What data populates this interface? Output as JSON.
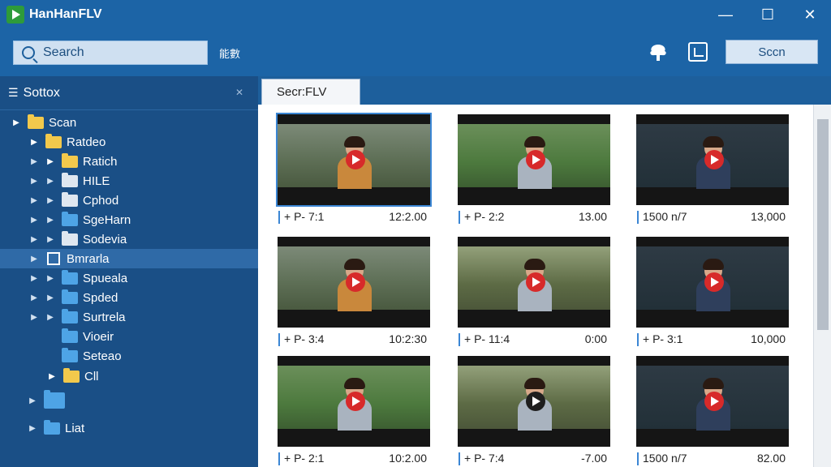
{
  "app": {
    "title": "HanHanFLV",
    "window_controls": {
      "minimize": "—",
      "maximize": "☐",
      "close": "✕"
    }
  },
  "toolbar": {
    "search_placeholder": "Search",
    "cjk_label": "能數",
    "scan_label": "Sccn"
  },
  "sidebar": {
    "title": "Sottox",
    "list_icon": "☰",
    "pin_icon": "✕",
    "items": [
      {
        "label": "Scan",
        "arrow": "▶",
        "icon": "folder-yellow"
      },
      {
        "label": "Ratdeo",
        "arrow": "▶",
        "icon": "folder-yellow"
      },
      {
        "label": "Ratich",
        "arrow": "▶",
        "icon": "folder-yellow"
      },
      {
        "label": "HILE",
        "arrow": "▶",
        "icon": "folder-white"
      },
      {
        "label": "Cphod",
        "arrow": "▶",
        "icon": "folder-white"
      },
      {
        "label": "SgeHarn",
        "arrow": "▶",
        "icon": "folder-blue"
      },
      {
        "label": "Sodevia",
        "arrow": "▶",
        "icon": "folder-white"
      },
      {
        "label": "Bmrarla",
        "arrow": "▶",
        "icon": "checkbox"
      },
      {
        "label": "Spueala",
        "arrow": "▶",
        "icon": "folder-blue"
      },
      {
        "label": "Spded",
        "arrow": "▶",
        "icon": "folder-blue"
      },
      {
        "label": "Surtrela",
        "arrow": "▶",
        "icon": "folder-blue"
      },
      {
        "label": "Vioeir",
        "arrow": "",
        "icon": "folder-blue"
      },
      {
        "label": "Seteao",
        "arrow": "",
        "icon": "folder-blue"
      },
      {
        "label": "Cll",
        "arrow": "▶",
        "icon": "folder-yellow"
      },
      {
        "label": "",
        "arrow": "▶",
        "icon": "folder-blue"
      },
      {
        "label": "Liat",
        "arrow": "▶",
        "icon": "folder-blue"
      }
    ]
  },
  "tab": {
    "label": "Secr:FLV"
  },
  "videos": [
    {
      "left": "+ P- 7:1",
      "right": "12:2.00",
      "scene": "forest",
      "body": "tan",
      "play": "red"
    },
    {
      "left": "+ P- 2:2",
      "right": "13.00",
      "scene": "green",
      "body": "grey",
      "play": "red"
    },
    {
      "left": "1500 n/7",
      "right": "13,000",
      "scene": "office",
      "body": "navy",
      "play": "red"
    },
    {
      "left": "+ P- 3:4",
      "right": "10:2:30",
      "scene": "forest",
      "body": "tan",
      "play": "red"
    },
    {
      "left": "+ P- 11:4",
      "right": "0:00",
      "scene": "park",
      "body": "grey",
      "play": "red"
    },
    {
      "left": "+ P- 3:1",
      "right": "10,000",
      "scene": "office",
      "body": "navy",
      "play": "red"
    },
    {
      "left": "+ P- 2:1",
      "right": "10:2.00",
      "scene": "green",
      "body": "grey",
      "play": "red"
    },
    {
      "left": "+ P- 7:4",
      "right": "-7.00",
      "scene": "park",
      "body": "grey",
      "play": "dark"
    },
    {
      "left": "1500 n/7",
      "right": "82.00",
      "scene": "office",
      "body": "navy",
      "play": "red"
    }
  ]
}
